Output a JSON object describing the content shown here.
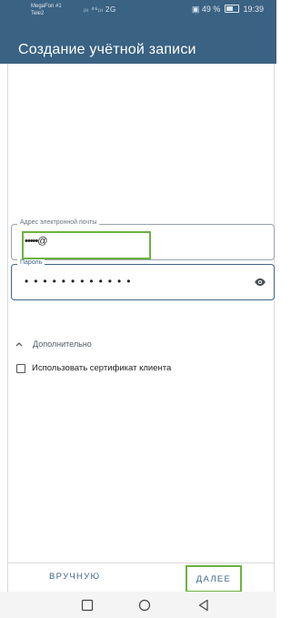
{
  "status_bar": {
    "carrier_line1": "MegaFon #1",
    "carrier_line2": "Tele2",
    "signal": "ᵢₗₗ ⁴⁶ᵢₗₗ 2G",
    "battery_text": "49 %",
    "time": "19:39"
  },
  "app_bar": {
    "title": "Создание учётной записи"
  },
  "form": {
    "email_label": "Адрес электронной почты",
    "email_value": "•••••@",
    "password_label": "Пароль",
    "password_value": "••••••••••••",
    "advanced_label": "Дополнительно",
    "client_cert_label": "Использовать сертификат клиента",
    "client_cert_checked": false
  },
  "actions": {
    "manual_label": "ВРУЧНУЮ",
    "next_label": "ДАЛЕЕ"
  },
  "colors": {
    "app_bar": "#3a6283",
    "accent": "#3f668a",
    "highlight": "#6cb33f"
  },
  "icons": {
    "password_toggle": "eye-icon",
    "advanced_toggle": "chevron-up-icon",
    "nav_recents": "square-icon",
    "nav_home": "circle-icon",
    "nav_back": "triangle-back-icon"
  }
}
